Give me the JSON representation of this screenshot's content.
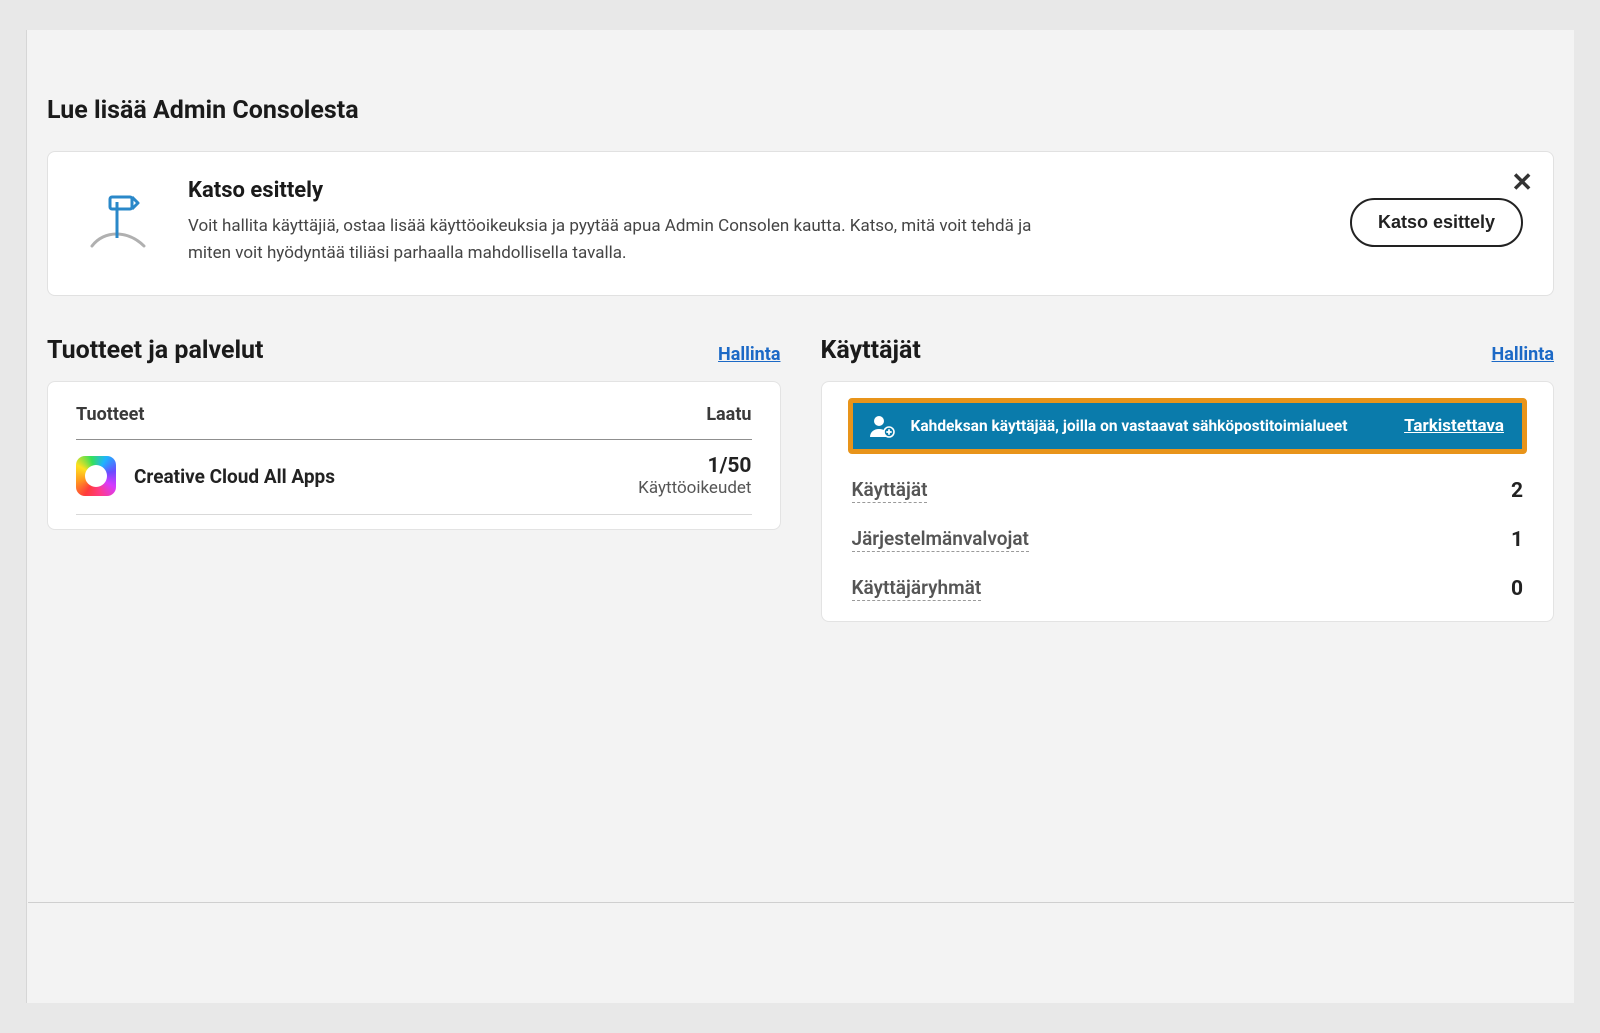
{
  "section_heading": "Lue lisää Admin Consolesta",
  "intro": {
    "title": "Katso esittely",
    "body": "Voit hallita käyttäjiä, ostaa lisää käyttöoikeuksia ja pyytää apua Admin Consolen kautta. Katso, mitä voit tehdä ja miten voit hyödyntää tiliäsi parhaalla mahdollisella tavalla.",
    "button": "Katso esittely"
  },
  "products": {
    "title": "Tuotteet ja palvelut",
    "manage": "Hallinta",
    "head_left": "Tuotteet",
    "head_right": "Laatu",
    "row": {
      "name": "Creative Cloud All Apps",
      "count": "1/50",
      "sub": "Käyttöoikeudet"
    }
  },
  "users": {
    "title": "Käyttäjät",
    "manage": "Hallinta",
    "banner_text": "Kahdeksan käyttäjää, joilla on vastaavat sähköpostitoimialueet",
    "banner_link": "Tarkistettava",
    "rows": [
      {
        "label": "Käyttäjät",
        "val": "2"
      },
      {
        "label": "Järjestelmänvalvojat",
        "val": "1"
      },
      {
        "label": "Käyttäjäryhmät",
        "val": "0"
      }
    ]
  }
}
